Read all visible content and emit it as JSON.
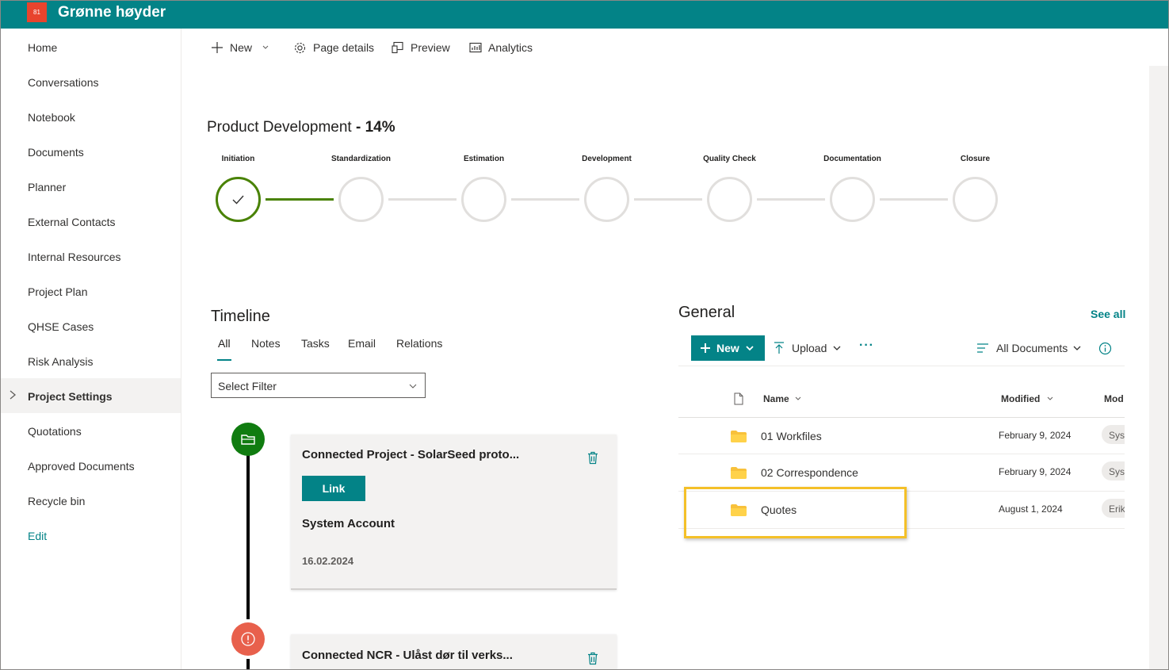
{
  "header": {
    "logo_text": "81",
    "site_title": "Grønne høyder"
  },
  "left_nav": {
    "items": [
      {
        "label": "Home"
      },
      {
        "label": "Conversations"
      },
      {
        "label": "Notebook"
      },
      {
        "label": "Documents"
      },
      {
        "label": "Planner"
      },
      {
        "label": "External Contacts"
      },
      {
        "label": "Internal Resources"
      },
      {
        "label": "Project Plan"
      },
      {
        "label": "QHSE Cases"
      },
      {
        "label": "Risk Analysis"
      },
      {
        "label": "Project Settings",
        "active": true
      },
      {
        "label": "Quotations"
      },
      {
        "label": "Approved Documents"
      },
      {
        "label": "Recycle bin"
      }
    ],
    "edit_label": "Edit"
  },
  "command_bar": {
    "new": "New",
    "page_details": "Page details",
    "preview": "Preview",
    "analytics": "Analytics"
  },
  "progress": {
    "title": "Product Development",
    "percent": " - 14%",
    "completed_steps": 1,
    "steps": [
      "Initiation",
      "Standardization",
      "Estimation",
      "Development",
      "Quality Check",
      "Documentation",
      "Closure"
    ]
  },
  "timeline": {
    "title": "Timeline",
    "tabs": [
      "All",
      "Notes",
      "Tasks",
      "Email",
      "Relations"
    ],
    "active_tab": "All",
    "filter_placeholder": "Select Filter",
    "entries": [
      {
        "title": "Connected Project - SolarSeed proto...",
        "button": "Link",
        "author": "System Account",
        "date": "16.02.2024",
        "icon_color": "#107c10"
      },
      {
        "title": "Connected NCR - Ulåst dør til verks...",
        "icon_color": "#e8604c"
      }
    ]
  },
  "documents": {
    "title": "General",
    "see_all": "See all",
    "new_label": "New",
    "upload_label": "Upload",
    "view_label": "All Documents",
    "columns": {
      "name": "Name",
      "modified": "Modified",
      "modified_by": "Mod"
    },
    "rows": [
      {
        "name": "01 Workfiles",
        "modified": "February 9, 2024",
        "modified_by": "Syst"
      },
      {
        "name": "02 Correspondence",
        "modified": "February 9, 2024",
        "modified_by": "Syst"
      },
      {
        "name": "Quotes",
        "modified": "August 1, 2024",
        "modified_by": "Erik"
      }
    ],
    "highlighted_row": "Quotes"
  },
  "colors": {
    "brand": "#038387",
    "complete": "#498205",
    "highlight": "#f4c028",
    "folder": "#f8c13b"
  }
}
